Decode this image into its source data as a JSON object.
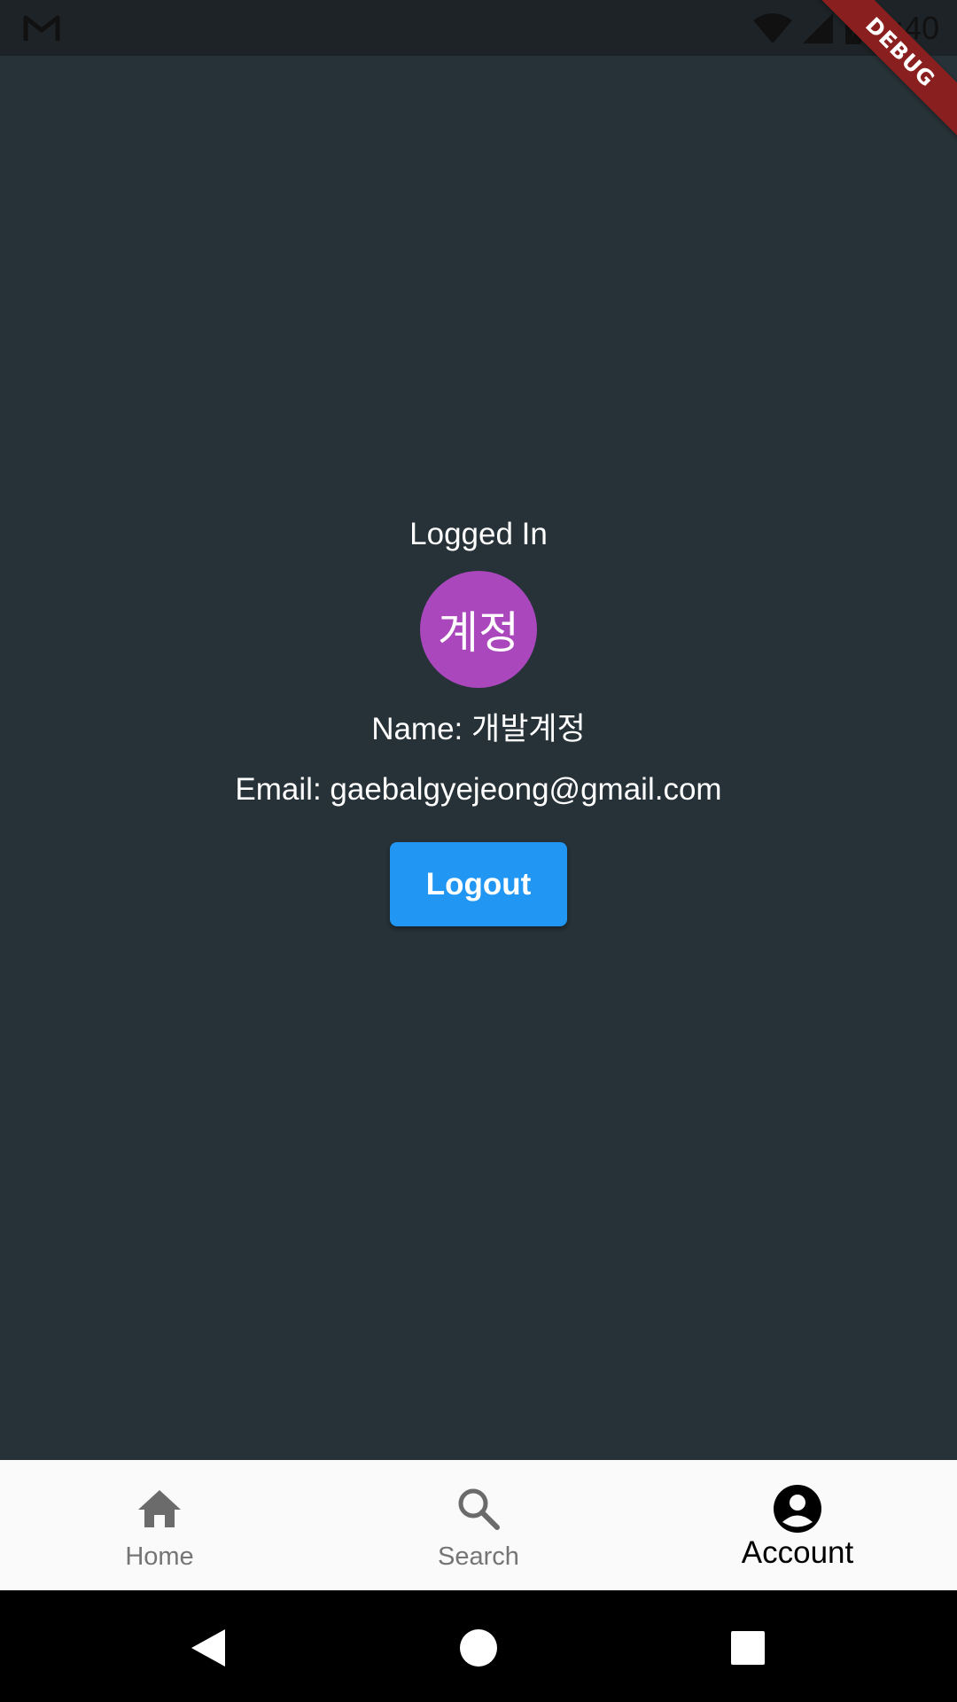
{
  "status_bar": {
    "left_icon": "gmail-m-icon",
    "wifi_icon": "wifi-icon",
    "signal_icon": "signal-icon",
    "battery_icon": "battery-charging-icon",
    "time": "4:40"
  },
  "debug_banner": {
    "label": "DEBUG",
    "color": "#8a1f1f"
  },
  "account": {
    "status_label": "Logged In",
    "avatar_text": "계정",
    "avatar_color": "#ab47bc",
    "name_line": "Name: 개발계정",
    "email_line": "Email: gaebalgyejeong@gmail.com",
    "logout_label": "Logout",
    "logout_color": "#2196f3"
  },
  "bottom_nav": {
    "items": [
      {
        "label": "Home",
        "icon": "home-icon",
        "active": false
      },
      {
        "label": "Search",
        "icon": "search-icon",
        "active": false
      },
      {
        "label": "Account",
        "icon": "account-circle-icon",
        "active": true
      }
    ]
  },
  "system_nav": {
    "back_icon": "back-triangle-icon",
    "home_icon": "home-circle-icon",
    "recents_icon": "recents-square-icon"
  },
  "colors": {
    "background": "#263238",
    "status_bar": "#1d2327",
    "bottom_nav_bg": "#fafafa",
    "inactive_nav": "#757575"
  }
}
